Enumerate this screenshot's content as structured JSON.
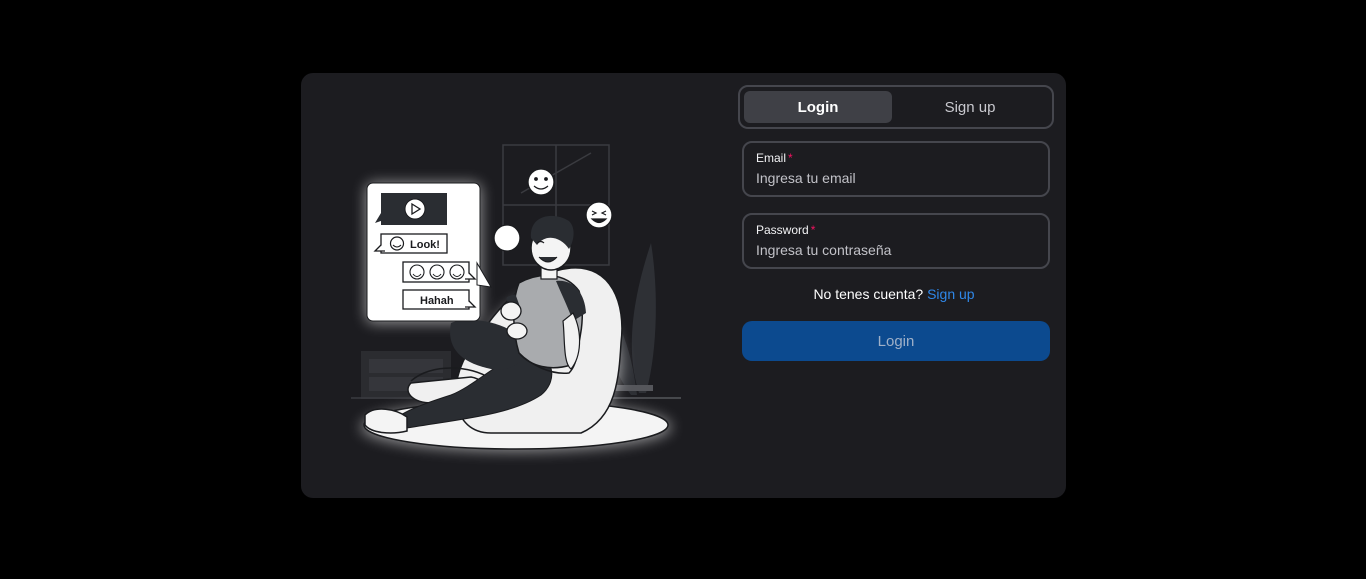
{
  "tabs": [
    {
      "label": "Login",
      "active": true
    },
    {
      "label": "Sign up",
      "active": false
    }
  ],
  "form": {
    "email": {
      "label": "Email",
      "required_mark": "*",
      "placeholder": "Ingresa tu email",
      "value": ""
    },
    "password": {
      "label": "Password",
      "required_mark": "*",
      "placeholder": "Ingresa tu contraseña",
      "value": ""
    },
    "signup_prompt": "No tenes cuenta?",
    "signup_link": "Sign up",
    "submit_label": "Login"
  },
  "illustration": {
    "bubble_look": "Look!",
    "bubble_hahah": "Hahah"
  },
  "colors": {
    "background": "#000000",
    "card": "#1c1c20",
    "border": "#45464d",
    "active_tab": "#3f4046",
    "primary_button": "#0c4a8f",
    "link": "#2f87e8",
    "required": "#f31260"
  }
}
